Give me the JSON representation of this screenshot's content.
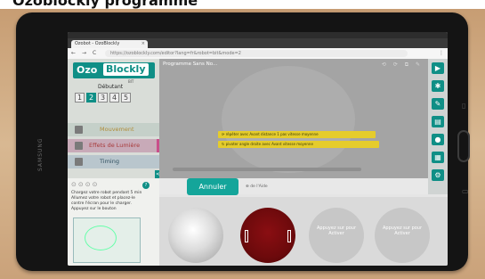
{
  "caption": {
    "text": "Ozoblockly programme"
  },
  "tablet": {
    "brand": "SAMSUNG"
  },
  "browser": {
    "tab_title": "Ozobot - OzoBlockly",
    "tab_close": "×",
    "address": "https://ozoblockly.com/editor?lang=fr&robot=bit&mode=2",
    "nav_back": "←",
    "nav_forward": "→",
    "nav_reload": "C",
    "menu": "⋮"
  },
  "left_panel": {
    "logo_main": "Ozo",
    "logo_accent": "Blockly",
    "logo_sub": "BIT",
    "level_label": "Débutant",
    "levels": [
      "1",
      "2",
      "3",
      "4",
      "5"
    ],
    "active_level": 2,
    "categories": [
      {
        "label": "Mouvement"
      },
      {
        "label": "Effets de Lumière"
      },
      {
        "label": "Timing"
      }
    ],
    "collapse_icon": "<"
  },
  "workspace": {
    "title": "Programme Sans No...",
    "tools": "⟲ ⟳ ⧉ ✎",
    "block1": "⟳ répéter   avec   Avant   distance   1   pas   vitesse   moyenne",
    "block2": "↻ pivoter angle   droite   avec   Avant   vitesse   moyenne"
  },
  "toolbar_right": {
    "icons": [
      "▶",
      "✱",
      "✎",
      "▤",
      "●",
      "▦",
      "⚙"
    ]
  },
  "bottom": {
    "cancel_label": "Annuler",
    "help_label": "⊕ de l'Aide",
    "progress": 0.6
  },
  "help_panel": {
    "steps": "⊙⊙⊙⊙",
    "step_badge": "?",
    "text_lines": [
      "Chargez votre robot pendant 5 min",
      "Allumez votre robot et placez-le",
      "contre l'écran pour le charger.",
      "Appuyez sur le bouton"
    ]
  },
  "circles": {
    "prompt_line1": "Appuyez sur pour",
    "prompt_line2": "Activer"
  },
  "colors": {
    "accent": "#0f8f86",
    "block": "#e5cc2c",
    "cancel": "#14a59a",
    "red_circle": "#7a0b0e"
  }
}
